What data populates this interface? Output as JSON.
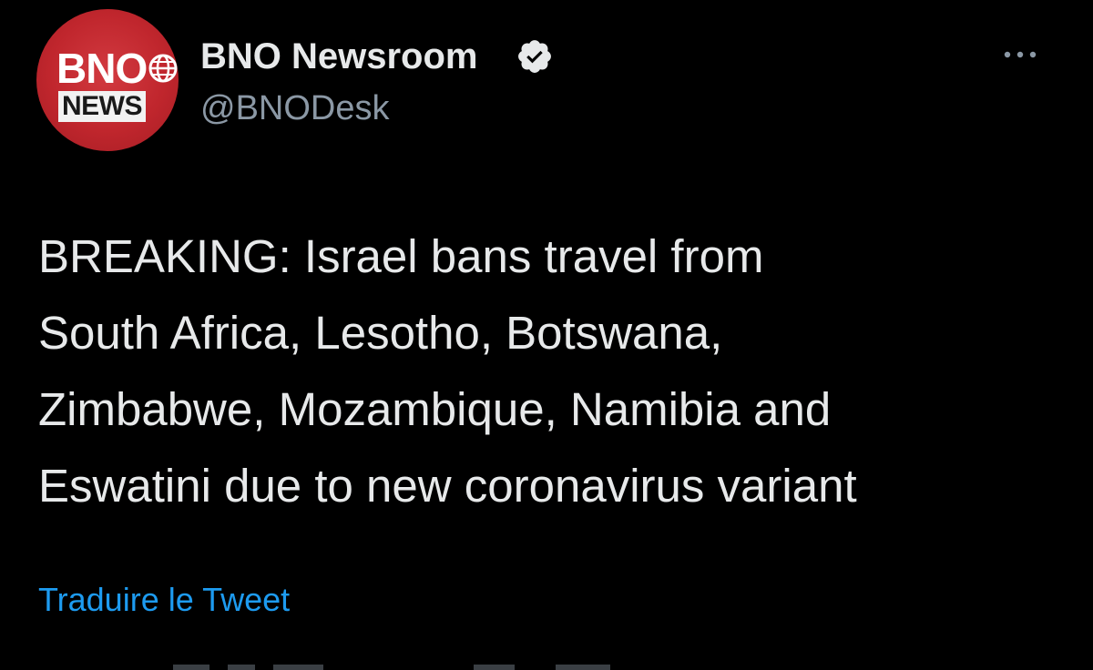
{
  "tweet": {
    "author": {
      "avatar_logo_top": "BNO",
      "avatar_logo_bottom": "NEWS",
      "display_name": "BNO Newsroom",
      "handle": "@BNODesk",
      "verified_icon": "verified-badge-icon"
    },
    "more_icon": "more-options-icon",
    "text": "BREAKING: Israel bans travel from\nSouth Africa, Lesotho, Botswana,\nZimbabwe, Mozambique, Namibia and\nEswatini due to new coronavirus variant",
    "translate_label": "Traduire le Tweet"
  },
  "colors": {
    "background": "#000000",
    "primary_text": "#e7e9ea",
    "secondary_text": "#8b98a5",
    "link": "#1d9bf0",
    "avatar_red": "#c0262d"
  }
}
